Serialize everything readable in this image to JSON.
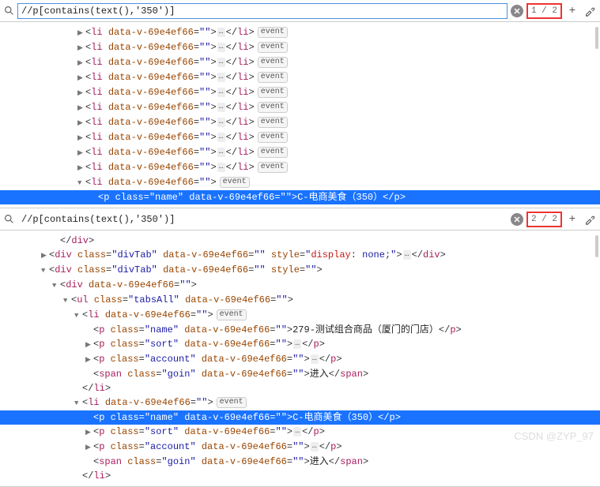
{
  "search_query": "//p[contains(text(),'350')]",
  "panel1": {
    "count": "1 / 2",
    "tree": [
      {
        "indent": 90,
        "arrow": "collapsed",
        "tag": "li",
        "attrs": [
          [
            "data-v-69e4ef66",
            ""
          ]
        ],
        "self_ellipsis": true,
        "close": "li",
        "badge": "event"
      },
      {
        "indent": 90,
        "arrow": "collapsed",
        "tag": "li",
        "attrs": [
          [
            "data-v-69e4ef66",
            ""
          ]
        ],
        "self_ellipsis": true,
        "close": "li",
        "badge": "event"
      },
      {
        "indent": 90,
        "arrow": "collapsed",
        "tag": "li",
        "attrs": [
          [
            "data-v-69e4ef66",
            ""
          ]
        ],
        "self_ellipsis": true,
        "close": "li",
        "badge": "event"
      },
      {
        "indent": 90,
        "arrow": "collapsed",
        "tag": "li",
        "attrs": [
          [
            "data-v-69e4ef66",
            ""
          ]
        ],
        "self_ellipsis": true,
        "close": "li",
        "badge": "event"
      },
      {
        "indent": 90,
        "arrow": "collapsed",
        "tag": "li",
        "attrs": [
          [
            "data-v-69e4ef66",
            ""
          ]
        ],
        "self_ellipsis": true,
        "close": "li",
        "badge": "event"
      },
      {
        "indent": 90,
        "arrow": "collapsed",
        "tag": "li",
        "attrs": [
          [
            "data-v-69e4ef66",
            ""
          ]
        ],
        "self_ellipsis": true,
        "close": "li",
        "badge": "event"
      },
      {
        "indent": 90,
        "arrow": "collapsed",
        "tag": "li",
        "attrs": [
          [
            "data-v-69e4ef66",
            ""
          ]
        ],
        "self_ellipsis": true,
        "close": "li",
        "badge": "event"
      },
      {
        "indent": 90,
        "arrow": "collapsed",
        "tag": "li",
        "attrs": [
          [
            "data-v-69e4ef66",
            ""
          ]
        ],
        "self_ellipsis": true,
        "close": "li",
        "badge": "event"
      },
      {
        "indent": 90,
        "arrow": "collapsed",
        "tag": "li",
        "attrs": [
          [
            "data-v-69e4ef66",
            ""
          ]
        ],
        "self_ellipsis": true,
        "close": "li",
        "badge": "event"
      },
      {
        "indent": 90,
        "arrow": "collapsed",
        "tag": "li",
        "attrs": [
          [
            "data-v-69e4ef66",
            ""
          ]
        ],
        "self_ellipsis": true,
        "close": "li",
        "badge": "event"
      },
      {
        "indent": 90,
        "arrow": "expanded",
        "tag": "li",
        "attrs": [
          [
            "data-v-69e4ef66",
            ""
          ]
        ],
        "badge": "event"
      },
      {
        "indent": 106,
        "arrow": "none",
        "highlight": true,
        "tag": "p",
        "attrs": [
          [
            "class",
            "name"
          ],
          [
            "data-v-69e4ef66",
            ""
          ]
        ],
        "text": "C-电商美食（350）",
        "close": "p"
      }
    ]
  },
  "panel2": {
    "count": "2 / 2",
    "tree": [
      {
        "indent": 58,
        "arrow": "none",
        "close_only": "div"
      },
      {
        "indent": 44,
        "arrow": "collapsed",
        "tag": "div",
        "attrs": [
          [
            "class",
            "divTab"
          ],
          [
            "data-v-69e4ef66",
            ""
          ],
          [
            "style",
            "display: none;"
          ]
        ],
        "self_ellipsis": true,
        "close": "div"
      },
      {
        "indent": 44,
        "arrow": "expanded",
        "tag": "div",
        "attrs": [
          [
            "class",
            "divTab"
          ],
          [
            "data-v-69e4ef66",
            ""
          ],
          [
            "style",
            ""
          ]
        ]
      },
      {
        "indent": 58,
        "arrow": "expanded",
        "tag": "div",
        "attrs": [
          [
            "data-v-69e4ef66",
            ""
          ]
        ]
      },
      {
        "indent": 72,
        "arrow": "expanded",
        "tag": "ul",
        "attrs": [
          [
            "class",
            "tabsAll"
          ],
          [
            "data-v-69e4ef66",
            ""
          ]
        ]
      },
      {
        "indent": 86,
        "arrow": "expanded",
        "tag": "li",
        "attrs": [
          [
            "data-v-69e4ef66",
            ""
          ]
        ],
        "badge": "event"
      },
      {
        "indent": 100,
        "arrow": "none",
        "tag": "p",
        "attrs": [
          [
            "class",
            "name"
          ],
          [
            "data-v-69e4ef66",
            ""
          ]
        ],
        "text": "279-测试组合商品（厦门的门店）",
        "close": "p"
      },
      {
        "indent": 100,
        "arrow": "collapsed",
        "tag": "p",
        "attrs": [
          [
            "class",
            "sort"
          ],
          [
            "data-v-69e4ef66",
            ""
          ]
        ],
        "self_ellipsis": true,
        "close": "p"
      },
      {
        "indent": 100,
        "arrow": "collapsed",
        "tag": "p",
        "attrs": [
          [
            "class",
            "account"
          ],
          [
            "data-v-69e4ef66",
            ""
          ]
        ],
        "self_ellipsis": true,
        "close": "p"
      },
      {
        "indent": 100,
        "arrow": "none",
        "tag": "span",
        "attrs": [
          [
            "class",
            "goin"
          ],
          [
            "data-v-69e4ef66",
            ""
          ]
        ],
        "text": "进入",
        "close": "span"
      },
      {
        "indent": 86,
        "arrow": "none",
        "close_only": "li"
      },
      {
        "indent": 86,
        "arrow": "expanded",
        "tag": "li",
        "attrs": [
          [
            "data-v-69e4ef66",
            ""
          ]
        ],
        "badge": "event"
      },
      {
        "indent": 100,
        "arrow": "none",
        "highlight": true,
        "tag": "p",
        "attrs": [
          [
            "class",
            "name"
          ],
          [
            "data-v-69e4ef66",
            ""
          ]
        ],
        "text": "C-电商美食（350）",
        "close": "p"
      },
      {
        "indent": 100,
        "arrow": "collapsed",
        "tag": "p",
        "attrs": [
          [
            "class",
            "sort"
          ],
          [
            "data-v-69e4ef66",
            ""
          ]
        ],
        "self_ellipsis": true,
        "close": "p"
      },
      {
        "indent": 100,
        "arrow": "collapsed",
        "tag": "p",
        "attrs": [
          [
            "class",
            "account"
          ],
          [
            "data-v-69e4ef66",
            ""
          ]
        ],
        "self_ellipsis": true,
        "close": "p"
      },
      {
        "indent": 100,
        "arrow": "none",
        "tag": "span",
        "attrs": [
          [
            "class",
            "goin"
          ],
          [
            "data-v-69e4ef66",
            ""
          ]
        ],
        "text": "进入",
        "close": "span"
      },
      {
        "indent": 86,
        "arrow": "none",
        "close_only": "li"
      }
    ]
  },
  "watermark": "CSDN @ZYP_97"
}
